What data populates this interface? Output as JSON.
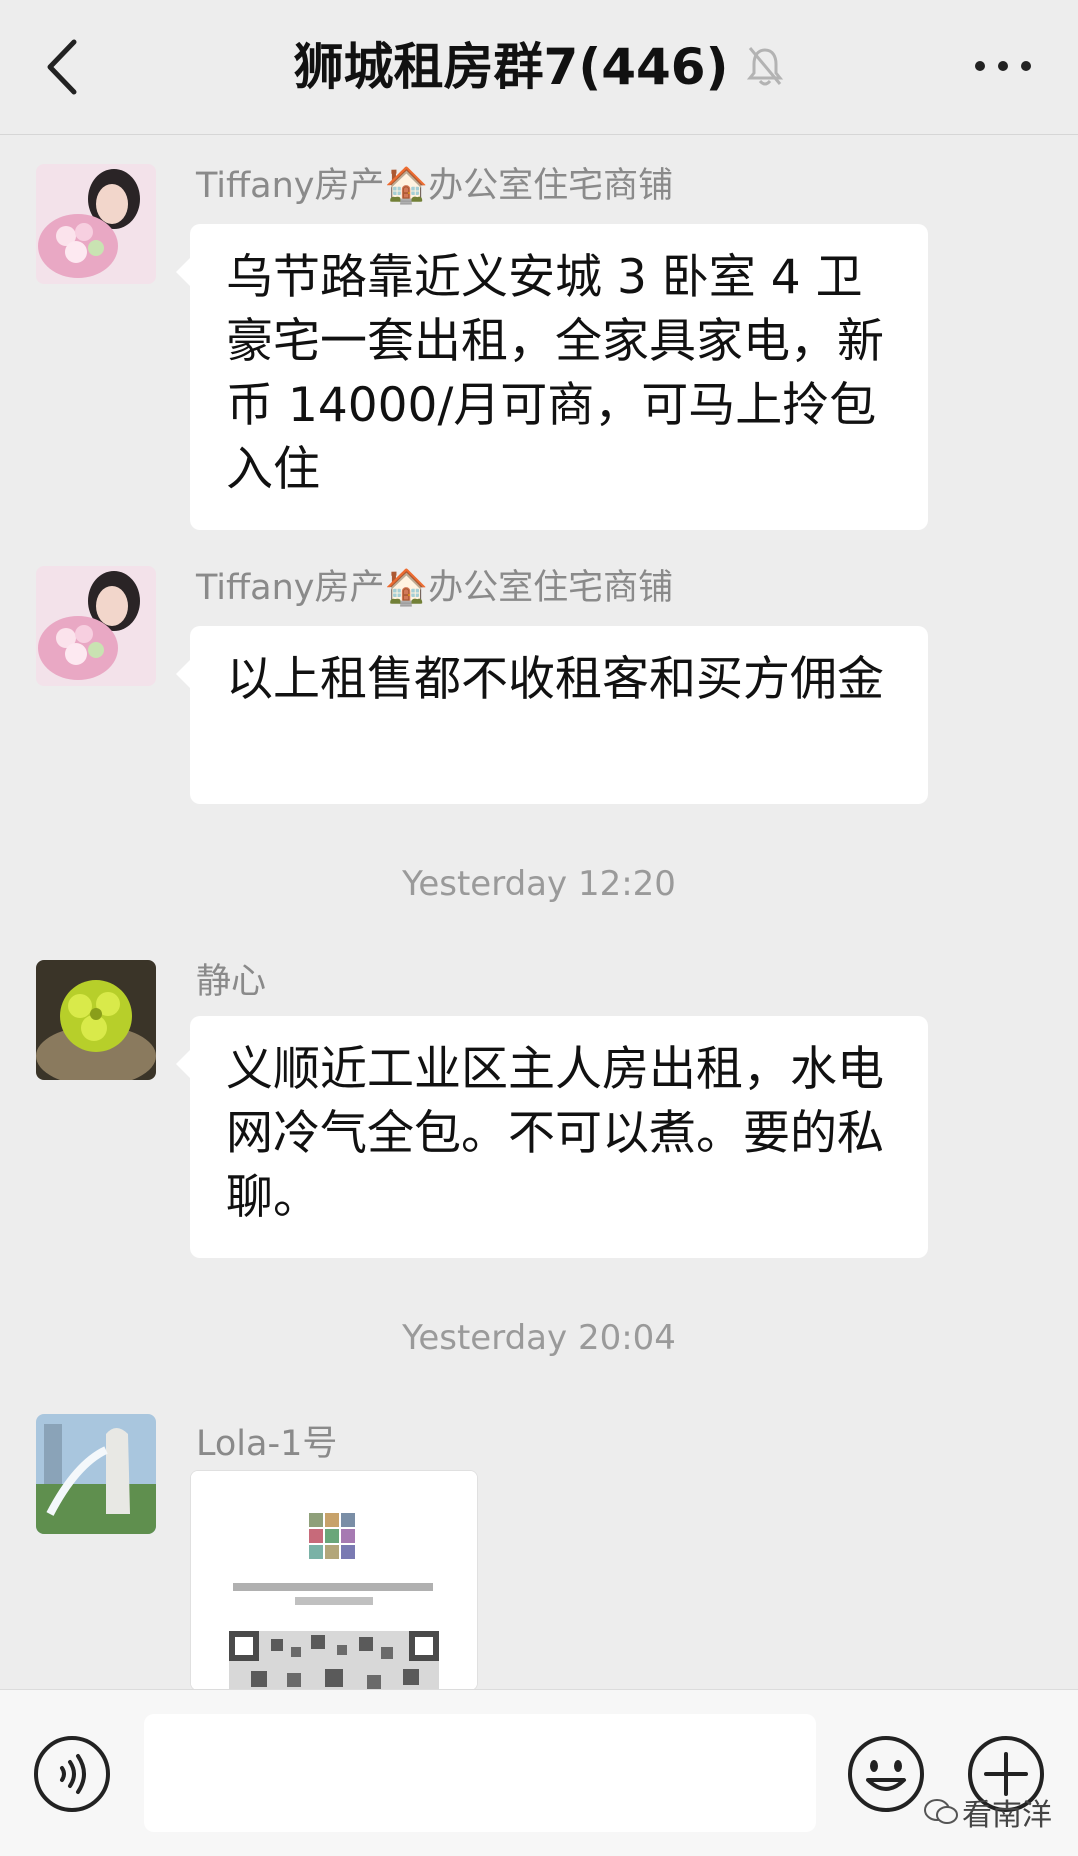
{
  "header": {
    "title": "狮城租房群7(446)"
  },
  "messages": [
    {
      "sender": "Tiffany房产🏠办公室住宅商铺",
      "text": "乌节路靠近义安城 3 卧室 4 卫豪宅一套出租，全家具家电，新币 14000/月可商，可马上拎包入住"
    },
    {
      "sender": "Tiffany房产🏠办公室住宅商铺",
      "text": "以上租售都不收租客和买方佣金"
    },
    {
      "sender": "静心",
      "text": "义顺近工业区主人房出租，水电网冷气全包。不可以煮。要的私聊。"
    },
    {
      "sender": "Lola-1号",
      "image": "qr-code-poster"
    }
  ],
  "timestamps": [
    "Yesterday 12:20",
    "Yesterday 20:04"
  ],
  "input": {
    "value": "",
    "placeholder": ""
  },
  "watermark": {
    "text": "看南洋"
  },
  "colors": {
    "background": "#ededed",
    "bubble": "#ffffff",
    "sender": "#8a8a8a",
    "timestamp": "#9a9a9a"
  }
}
